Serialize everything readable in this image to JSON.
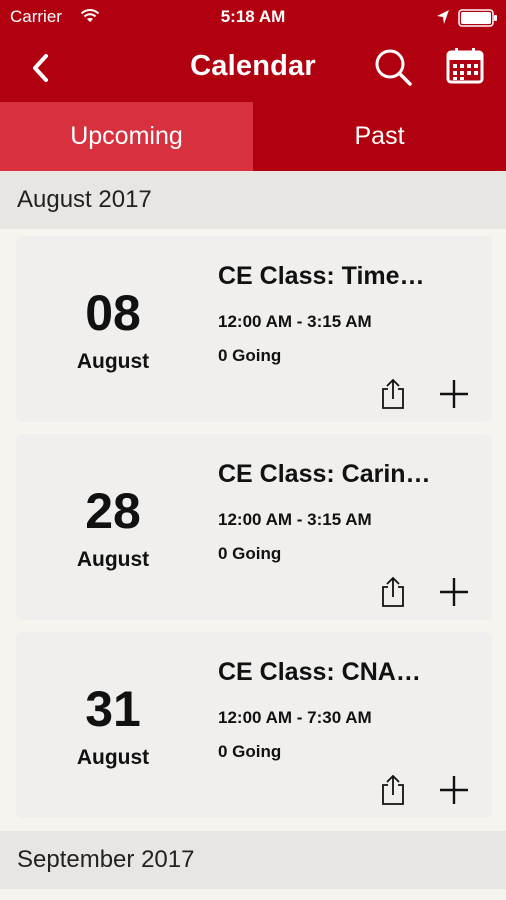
{
  "status_bar": {
    "carrier": "Carrier",
    "time": "5:18 AM",
    "icons": [
      "wifi-icon",
      "location-arrow-icon",
      "battery-icon"
    ]
  },
  "nav": {
    "title": "Calendar",
    "icons": [
      "back-chevron-icon",
      "search-icon",
      "calendar-icon"
    ]
  },
  "tabs": {
    "upcoming": "Upcoming",
    "past": "Past"
  },
  "sections": [
    {
      "header": "August 2017",
      "events": [
        {
          "day": "08",
          "month": "August",
          "title": "CE Class: Time…",
          "time": "12:00 AM - 3:15 AM",
          "going": "0 Going"
        },
        {
          "day": "28",
          "month": "August",
          "title": "CE Class: Carin…",
          "time": "12:00 AM - 3:15 AM",
          "going": "0 Going"
        },
        {
          "day": "31",
          "month": "August",
          "title": "CE Class: CNA…",
          "time": "12:00 AM - 7:30 AM",
          "going": "0 Going"
        }
      ]
    },
    {
      "header": "September 2017",
      "events": []
    }
  ],
  "colors": {
    "brand": "#b1000f",
    "tab_active": "#d7313f",
    "background": "#f7f4f0",
    "card": "#f0efed",
    "section_header": "#e8e6e3"
  }
}
